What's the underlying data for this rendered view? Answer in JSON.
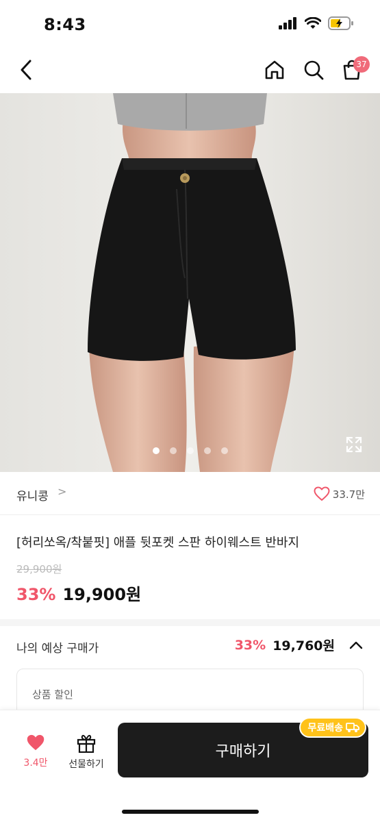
{
  "status_bar": {
    "time": "8:43"
  },
  "header": {
    "cart_count": "37"
  },
  "gallery": {
    "total_images": 5,
    "active_index": 0
  },
  "brand": {
    "name": "유니콩",
    "chevron": ">",
    "like_count": "33.7만"
  },
  "product": {
    "title": "[허리쏘옥/착붙핏] 애플 뒷포켓 스판 하이웨스트 반바지",
    "original_price": "29,900원",
    "discount_rate": "33%",
    "sale_price": "19,900원"
  },
  "expected_price": {
    "label": "나의 예상 구매가",
    "discount_rate": "33%",
    "price": "19,760원"
  },
  "discount_card": {
    "label": "상품 할인"
  },
  "bottom_bar": {
    "wish_count": "3.4만",
    "gift_label": "선물하기",
    "buy_label": "구매하기",
    "shipping_badge": "무료배송"
  },
  "colors": {
    "accent": "#f0566a",
    "badge": "#ffc21a",
    "buy_button": "#1c1c1c"
  }
}
